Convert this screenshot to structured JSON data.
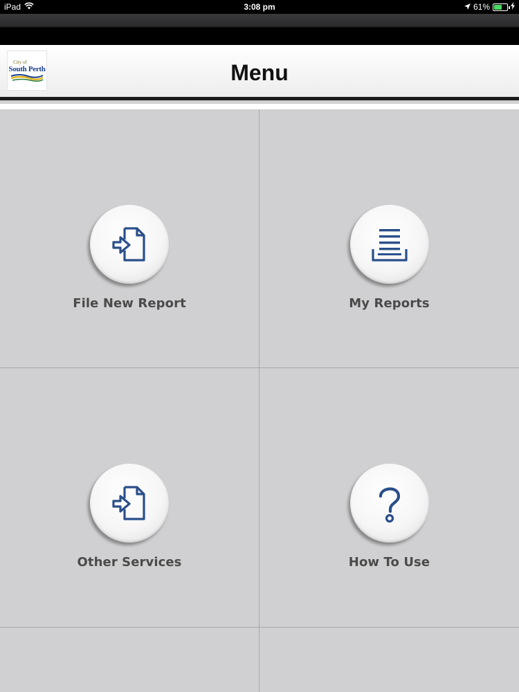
{
  "status_bar": {
    "device": "iPad",
    "time": "3:08 pm",
    "battery": "61%",
    "battery_fraction": 0.61,
    "icons": [
      "wifi-icon",
      "location-arrow-icon",
      "battery-icon",
      "charging-bolt-icon"
    ]
  },
  "header": {
    "title": "Menu",
    "logo": {
      "small_text": "City of",
      "main_text": "South Perth"
    }
  },
  "colors": {
    "background": "#d0cfd1",
    "icon_blue": "#2a4f8a",
    "label_text": "#4a4a4a",
    "battery_green": "#4cd964"
  },
  "menu": {
    "items": [
      {
        "label": "File New Report",
        "icon": "file-import-icon"
      },
      {
        "label": "My Reports",
        "icon": "reports-tray-icon"
      },
      {
        "label": "Other Services",
        "icon": "file-import-icon"
      },
      {
        "label": "How To Use",
        "icon": "question-mark-icon"
      }
    ]
  }
}
